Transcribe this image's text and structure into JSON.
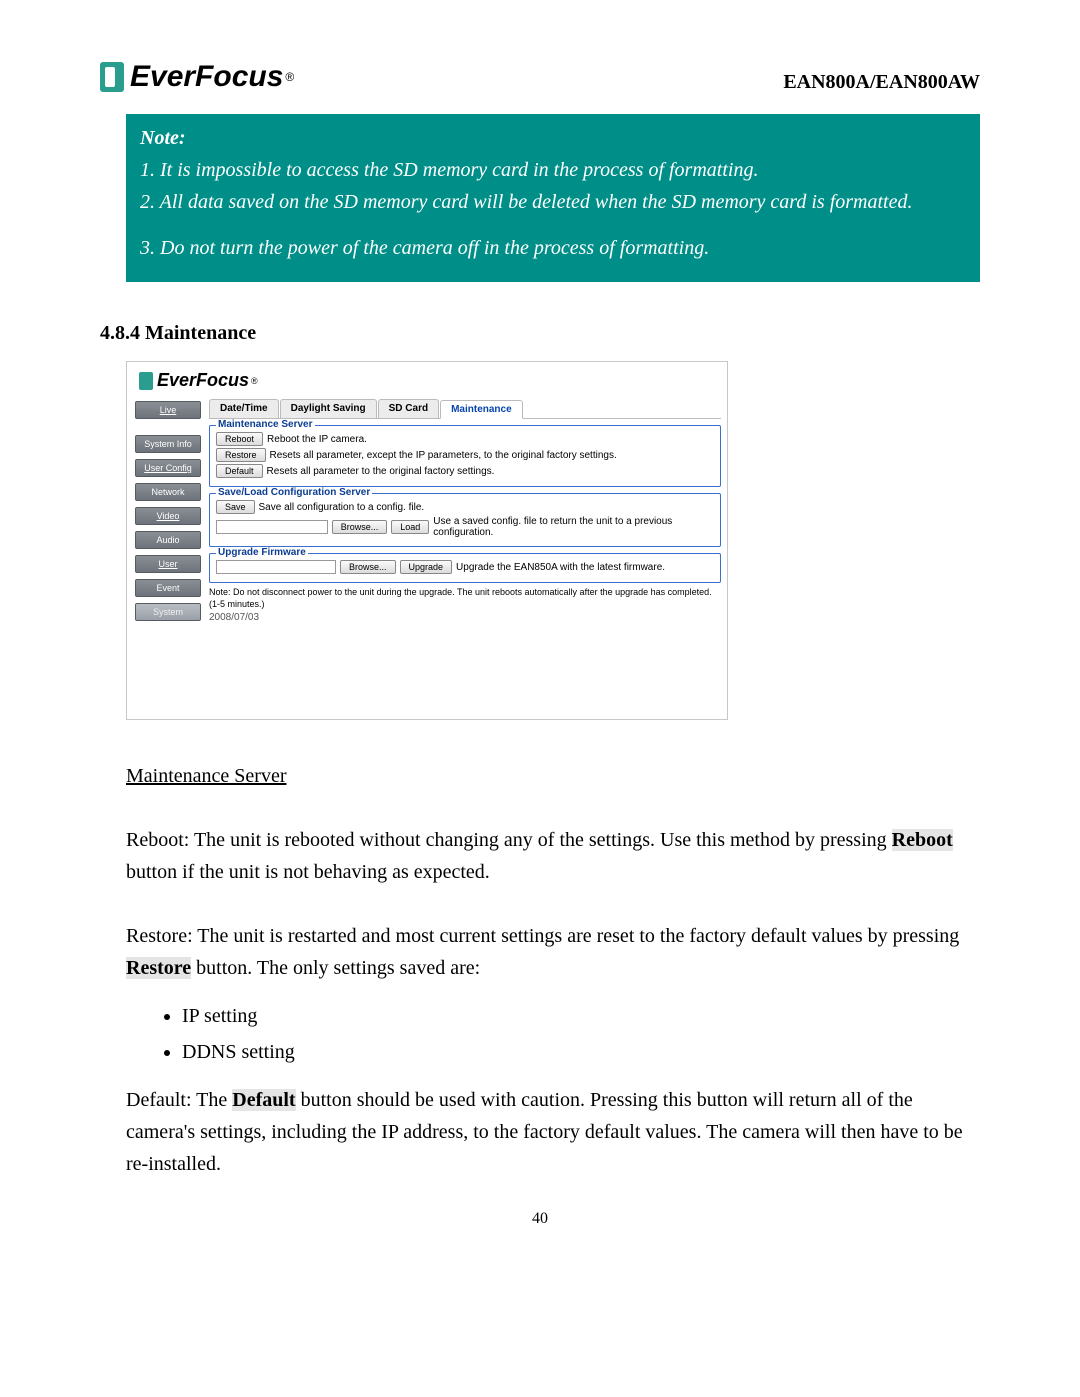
{
  "header": {
    "brand": "EverFocus",
    "reg": "®",
    "model": "EAN800A/EAN800AW"
  },
  "note": {
    "title": "Note:",
    "line1": "1. It is impossible to access the SD memory card in the process of formatting.",
    "line2": "2. All data saved on the SD memory card will be deleted when the SD memory card is formatted.",
    "line3": "3. Do not turn the power of the camera off in the process of formatting."
  },
  "section_heading": "4.8.4 Maintenance",
  "app": {
    "brand": "EverFocus",
    "reg": "®",
    "sidebar": {
      "live": "Live",
      "system_info": "System Info",
      "user_config": "User Config",
      "network": "Network",
      "video": "Video",
      "audio": "Audio",
      "user": "User",
      "event": "Event",
      "system": "System"
    },
    "tabs": {
      "datetime": "Date/Time",
      "daylight": "Daylight Saving",
      "sdcard": "SD Card",
      "maintenance": "Maintenance"
    },
    "maint_server": {
      "legend": "Maintenance Server",
      "reboot_btn": "Reboot",
      "reboot_desc": "Reboot the IP camera.",
      "restore_btn": "Restore",
      "restore_desc": "Resets all parameter, except the IP parameters, to the original factory settings.",
      "default_btn": "Default",
      "default_desc": "Resets all parameter to the original factory settings."
    },
    "saveload": {
      "legend": "Save/Load Configuration Server",
      "save_btn": "Save",
      "save_desc": "Save all configuration to a config. file.",
      "browse_btn": "Browse...",
      "load_btn": "Load",
      "load_desc": "Use a saved config. file to return the unit to a previous configuration."
    },
    "upgrade": {
      "legend": "Upgrade Firmware",
      "browse_btn": "Browse...",
      "upgrade_btn": "Upgrade",
      "desc": "Upgrade the EAN850A with the latest firmware.",
      "note": "Note: Do not disconnect power to the unit during the upgrade. The unit reboots automatically after the upgrade has completed. (1-5 minutes.)"
    },
    "date": "2008/07/03"
  },
  "body": {
    "maint_server_heading": "Maintenance Server",
    "reboot_p1": "Reboot: The unit is rebooted without changing any of the settings. Use this method by pressing ",
    "reboot_bold": "Reboot",
    "reboot_p2": " button if the unit is not behaving as expected.",
    "restore_p1": "Restore: The unit is restarted and most current settings are reset to the factory default values by pressing ",
    "restore_bold": "Restore",
    "restore_p2": " button. The only settings saved are:",
    "bullet1": "IP setting",
    "bullet2": "DDNS setting",
    "default_p1": "Default: The ",
    "default_bold": "Default",
    "default_p2": " button should be used with caution. Pressing this button will return all of the camera's settings, including the IP address, to the factory default values. The camera will then have to be re-installed."
  },
  "page_number": "40"
}
